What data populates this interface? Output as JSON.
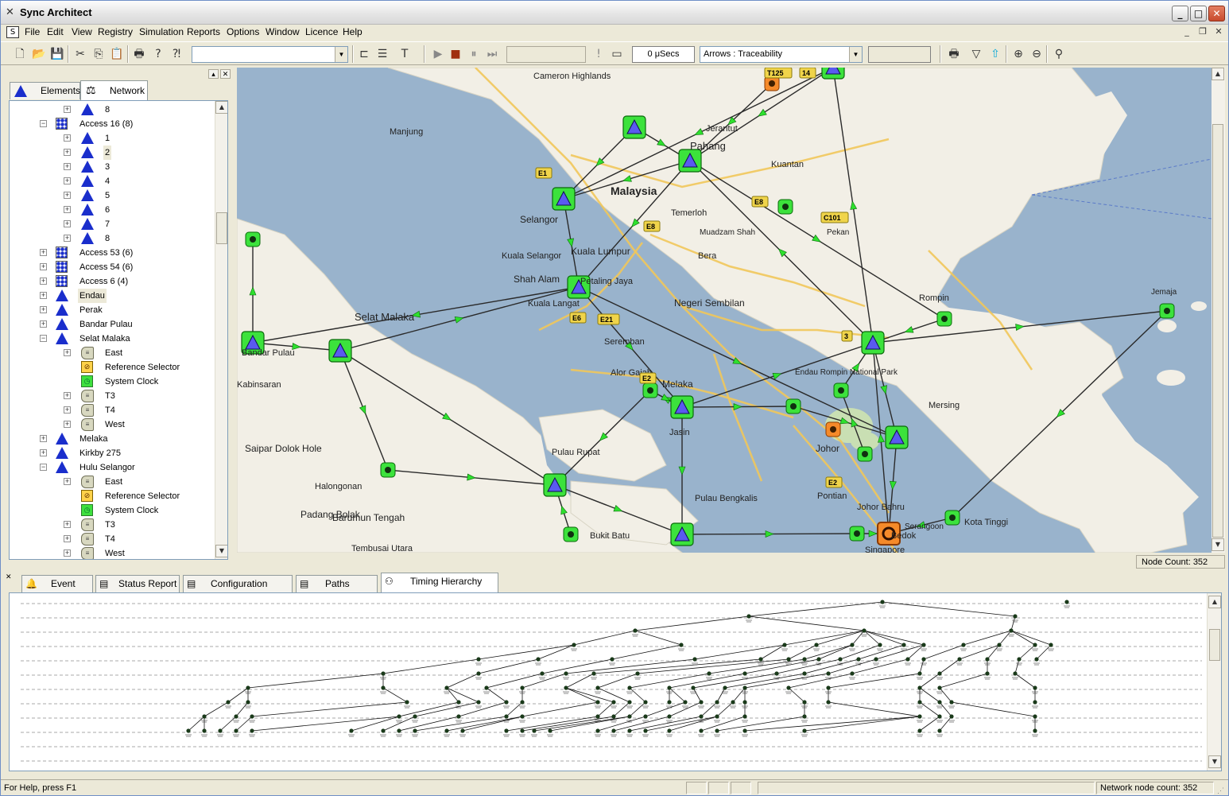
{
  "window": {
    "title": "Sync Architect"
  },
  "menu": [
    "File",
    "Edit",
    "View",
    "Registry",
    "Simulation",
    "Reports",
    "Options",
    "Window",
    "Licence",
    "Help"
  ],
  "toolbar": {
    "time_value": "0 μSecs",
    "arrows_combo": "Arrows : Traceability",
    "left_combo": ""
  },
  "left_panel": {
    "tabs": [
      {
        "label": "Elements",
        "icon": "triangle-icon"
      },
      {
        "label": "Network",
        "icon": "network-icon",
        "active": true
      }
    ],
    "tree": [
      {
        "depth": 2,
        "expander": "+",
        "icon": "ne",
        "label": "8"
      },
      {
        "depth": 1,
        "expander": "-",
        "icon": "access",
        "label": "Access 16 (8)"
      },
      {
        "depth": 2,
        "expander": "+",
        "icon": "ne",
        "label": "1"
      },
      {
        "depth": 2,
        "expander": "+",
        "icon": "ne",
        "label": "2",
        "selected": true
      },
      {
        "depth": 2,
        "expander": "+",
        "icon": "ne",
        "label": "3"
      },
      {
        "depth": 2,
        "expander": "+",
        "icon": "ne",
        "label": "4"
      },
      {
        "depth": 2,
        "expander": "+",
        "icon": "ne",
        "label": "5"
      },
      {
        "depth": 2,
        "expander": "+",
        "icon": "ne",
        "label": "6"
      },
      {
        "depth": 2,
        "expander": "+",
        "icon": "ne",
        "label": "7"
      },
      {
        "depth": 2,
        "expander": "+",
        "icon": "ne",
        "label": "8"
      },
      {
        "depth": 1,
        "expander": "+",
        "icon": "access",
        "label": "Access 53 (6)"
      },
      {
        "depth": 1,
        "expander": "+",
        "icon": "access",
        "label": "Access 54 (6)"
      },
      {
        "depth": 1,
        "expander": "+",
        "icon": "access",
        "label": "Access 6 (4)"
      },
      {
        "depth": 1,
        "expander": "+",
        "icon": "ne",
        "label": "Endau",
        "selected": true
      },
      {
        "depth": 1,
        "expander": "+",
        "icon": "ne",
        "label": "Perak"
      },
      {
        "depth": 1,
        "expander": "+",
        "icon": "ne",
        "label": "Bandar Pulau"
      },
      {
        "depth": 1,
        "expander": "-",
        "icon": "ne",
        "label": "Selat Malaka"
      },
      {
        "depth": 2,
        "expander": "+",
        "icon": "clock",
        "label": "East"
      },
      {
        "depth": 2,
        "expander": "",
        "icon": "refsel",
        "label": "Reference Selector"
      },
      {
        "depth": 2,
        "expander": "",
        "icon": "sysclk",
        "label": "System Clock"
      },
      {
        "depth": 2,
        "expander": "+",
        "icon": "clock",
        "label": "T3"
      },
      {
        "depth": 2,
        "expander": "+",
        "icon": "clock",
        "label": "T4"
      },
      {
        "depth": 2,
        "expander": "+",
        "icon": "clock",
        "label": "West"
      },
      {
        "depth": 1,
        "expander": "+",
        "icon": "ne",
        "label": "Melaka"
      },
      {
        "depth": 1,
        "expander": "+",
        "icon": "ne",
        "label": "Kirkby 275"
      },
      {
        "depth": 1,
        "expander": "-",
        "icon": "ne",
        "label": "Hulu Selangor"
      },
      {
        "depth": 2,
        "expander": "+",
        "icon": "clock",
        "label": "East"
      },
      {
        "depth": 2,
        "expander": "",
        "icon": "refsel",
        "label": "Reference Selector"
      },
      {
        "depth": 2,
        "expander": "",
        "icon": "sysclk",
        "label": "System Clock"
      },
      {
        "depth": 2,
        "expander": "+",
        "icon": "clock",
        "label": "T3"
      },
      {
        "depth": 2,
        "expander": "+",
        "icon": "clock",
        "label": "T4"
      },
      {
        "depth": 2,
        "expander": "+",
        "icon": "clock",
        "label": "West"
      }
    ]
  },
  "map": {
    "place_labels": [
      "Malaysia",
      "Selangor",
      "Kuala Lumpur",
      "Shah Alam",
      "Petaling Jaya",
      "Kuala Selangor",
      "Kuala Langat",
      "Negeri Sembilan",
      "Seremban",
      "Alor Gajah",
      "Melaka",
      "Jasin",
      "Johor",
      "Johor Bahru",
      "Pontian",
      "Kota Tinggi",
      "Rompin",
      "Mersing",
      "Endau Rompin National Park",
      "Pahang",
      "Kuantan",
      "Pekan",
      "Bera",
      "Temerloh",
      "Selat Malaka",
      "Bandar Pulau",
      "Kabinsaran",
      "Saipar Dolok Hole",
      "Halongonan",
      "Padang Bolak",
      "Barumun Tengah",
      "Tembusai Utara",
      "Bukit Batu",
      "Pulau Rupat",
      "Pulau Bengkalis",
      "Singapore",
      "Cameron Highlands",
      "Manjung",
      "Jerantut",
      "Muadzam Shah",
      "Jemaja",
      "Bedok",
      "Serangoon"
    ],
    "road_shields": [
      "E1",
      "E8",
      "E8",
      "C101",
      "E6",
      "E21",
      "E2",
      "E2",
      "T125",
      "14",
      "3"
    ]
  },
  "map_status": "Node Count: 352",
  "bottom_tabs": [
    {
      "label": "Event Log",
      "icon": "bell-icon"
    },
    {
      "label": "Status Report",
      "icon": "report-icon"
    },
    {
      "label": "Configuration Report",
      "icon": "report-icon"
    },
    {
      "label": "Paths Report",
      "icon": "report-icon"
    },
    {
      "label": "Timing Hierarchy Tree",
      "icon": "hierarchy-icon",
      "active": true
    }
  ],
  "status_bar": {
    "help": "For Help, press F1",
    "node_count": "Network node count: 352"
  }
}
